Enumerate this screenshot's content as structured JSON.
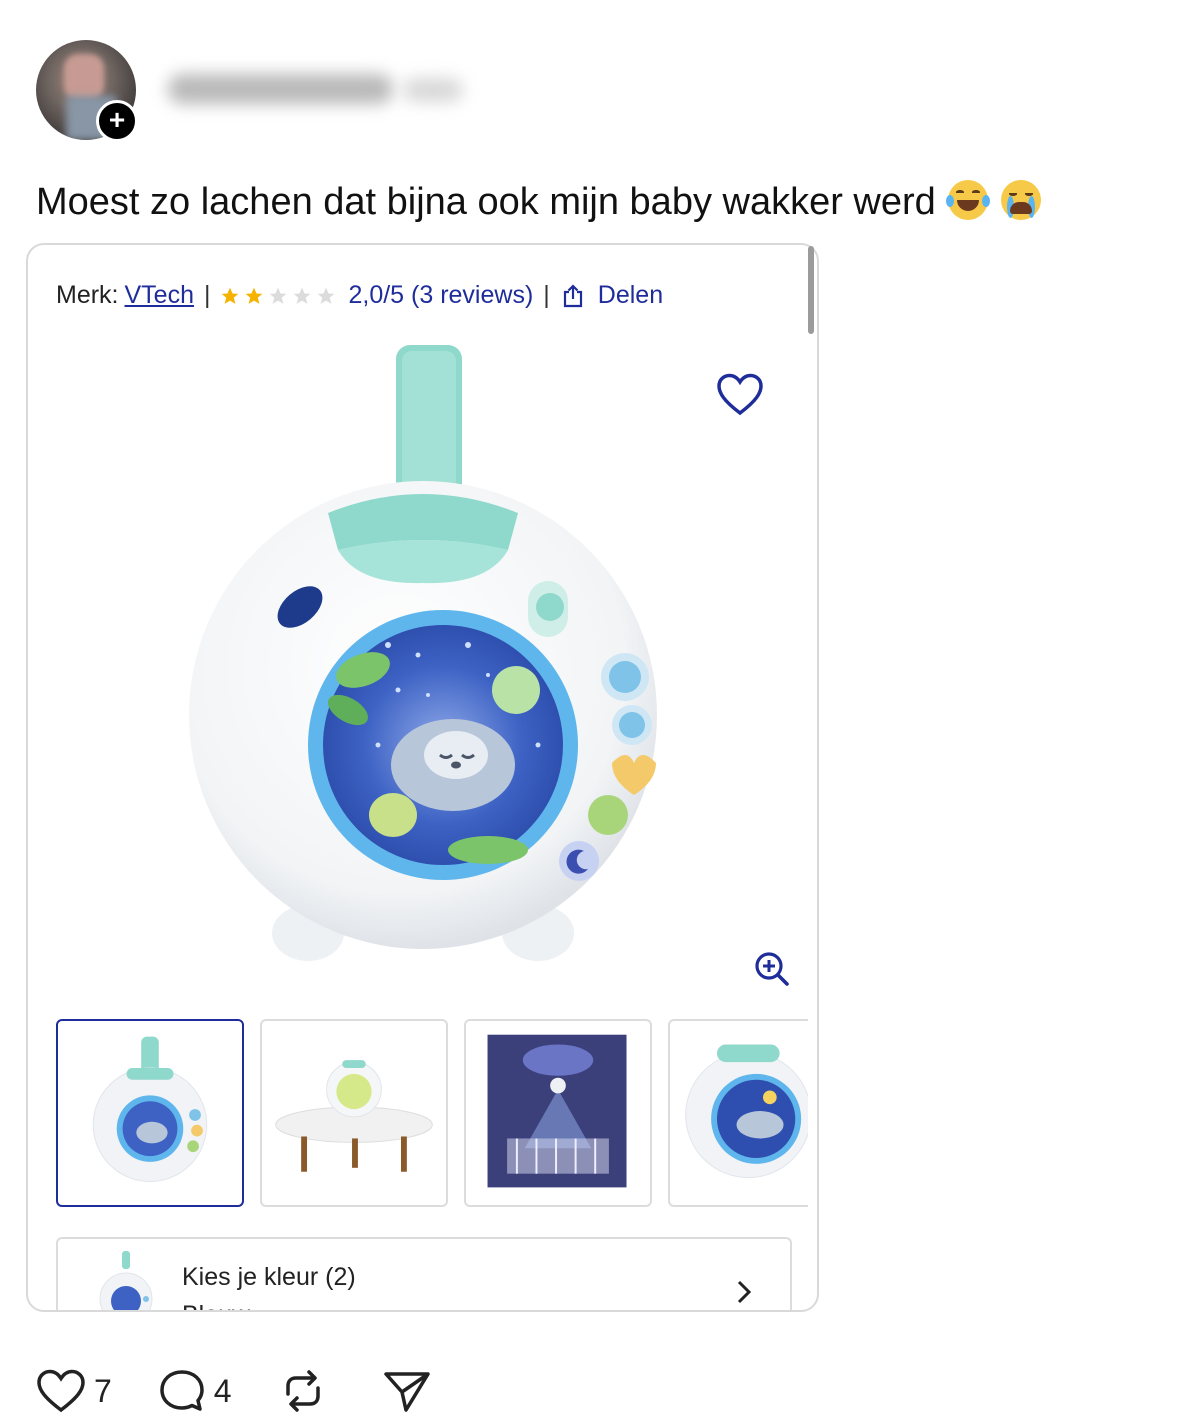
{
  "post": {
    "text": "Moest zo lachen dat bijna ook mijn baby wakker werd",
    "emojis": [
      "tears-of-joy",
      "loudly-crying"
    ],
    "follow_symbol": "+"
  },
  "product_card": {
    "brand_prefix": "Merk:",
    "brand": "VTech",
    "separator": "|",
    "rating_stars_filled": 2,
    "rating_stars_total": 5,
    "rating_text": "2,0/5 (3 reviews)",
    "share_label": "Delen",
    "variant_label": "Kies je kleur (2)",
    "variant_value": "Blauw",
    "colors": {
      "link": "#1f2d9b",
      "star_filled": "#f5b300",
      "star_empty": "#d9d9d9",
      "teal": "#8fd8cc"
    }
  },
  "actions": {
    "likes": "7",
    "comments": "4"
  }
}
